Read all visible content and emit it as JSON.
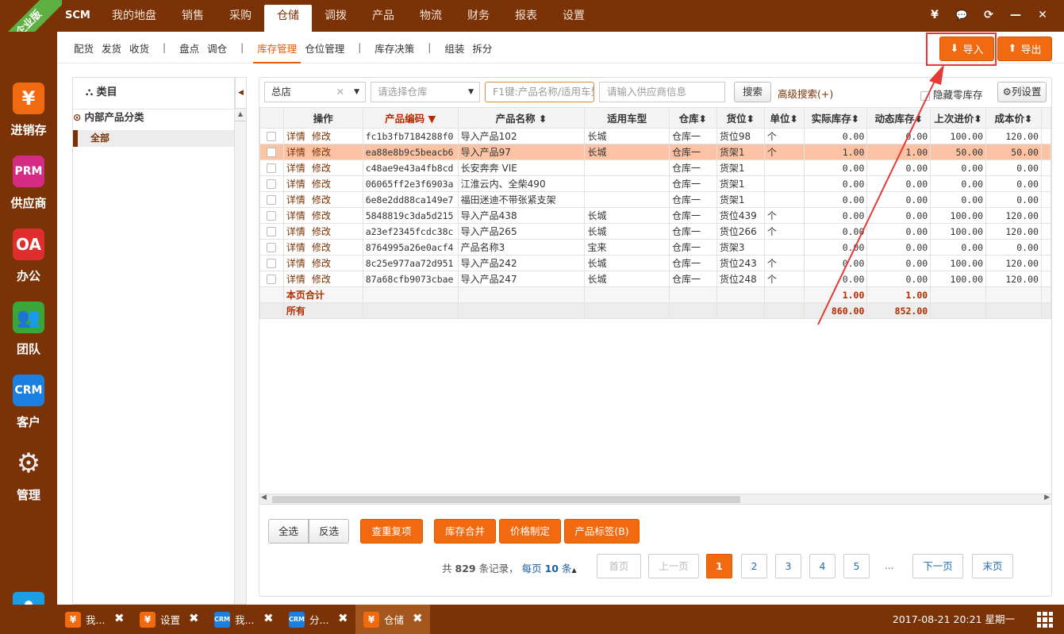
{
  "app": {
    "brand": "SCM",
    "edition_ribbon": "企业版"
  },
  "topnav": [
    "我的地盘",
    "销售",
    "采购",
    "仓储",
    "调拨",
    "产品",
    "物流",
    "财务",
    "报表",
    "设置"
  ],
  "topnav_active": "仓储",
  "window_controls": {
    "currency": "¥",
    "chat": "💬",
    "refresh": "⟳",
    "minimize": "—",
    "close": "✕"
  },
  "sidebar": [
    {
      "icon": "¥",
      "label": "进销存",
      "color": "#f16a10"
    },
    {
      "icon": "PRM",
      "label": "供应商",
      "color": "#d62b85"
    },
    {
      "icon": "OA",
      "label": "办公",
      "color": "#e02d2d"
    },
    {
      "icon": "👥",
      "label": "团队",
      "color": "#3aa63a"
    },
    {
      "icon": "CRM",
      "label": "客户",
      "color": "#1a7fe0"
    },
    {
      "icon": "⚙",
      "label": "管理",
      "color": "#7a3206"
    }
  ],
  "subnav": {
    "groups": [
      [
        "配货",
        "发货",
        "收货"
      ],
      [
        "盘点",
        "调仓"
      ],
      [
        "库存管理",
        "仓位管理"
      ],
      [
        "库存决策"
      ],
      [
        "组装",
        "拆分"
      ]
    ],
    "active": "库存管理",
    "import_label": "导入",
    "export_label": "导出"
  },
  "category": {
    "title": "类目",
    "root": "内部产品分类",
    "all": "全部"
  },
  "filters": {
    "store": "总店",
    "warehouse_placeholder": "请选择仓库",
    "product_placeholder": "F1键:产品名称/适用车型",
    "supplier_placeholder": "请输入供应商信息",
    "search_label": "搜索",
    "advanced_label": "高级搜索(+)",
    "hide_zero_label": "隐藏零库存",
    "column_settings_label": "列设置"
  },
  "table": {
    "headers": [
      "操作",
      "产品编码",
      "产品名称",
      "适用车型",
      "仓库",
      "货位",
      "单位",
      "实际库存",
      "动态库存",
      "上次进价",
      "成本价"
    ],
    "detail_label": "详情",
    "edit_label": "修改",
    "rows": [
      {
        "code": "fc1b3fb7184288f0",
        "name": "导入产品102",
        "car": "长城",
        "wh": "仓库一",
        "loc": "货位98",
        "unit": "个",
        "actual": "0.00",
        "dynamic": "0.00",
        "last_price": "100.00",
        "cost": "120.00"
      },
      {
        "code": "ea88e8b9c5beacb6",
        "name": "导入产品97",
        "car": "长城",
        "wh": "仓库一",
        "loc": "货架1",
        "unit": "个",
        "actual": "1.00",
        "dynamic": "1.00",
        "last_price": "50.00",
        "cost": "50.00"
      },
      {
        "code": "c48ae9e43a4fb8cd",
        "name": "长安奔奔 VIE",
        "car": "",
        "wh": "仓库一",
        "loc": "货架1",
        "unit": "",
        "actual": "0.00",
        "dynamic": "0.00",
        "last_price": "0.00",
        "cost": "0.00"
      },
      {
        "code": "06065ff2e3f6903a",
        "name": "江淮云内、全柴490",
        "car": "",
        "wh": "仓库一",
        "loc": "货架1",
        "unit": "",
        "actual": "0.00",
        "dynamic": "0.00",
        "last_price": "0.00",
        "cost": "0.00"
      },
      {
        "code": "6e8e2dd88ca149e7",
        "name": "福田迷迪不带张紧支架",
        "car": "",
        "wh": "仓库一",
        "loc": "货架1",
        "unit": "",
        "actual": "0.00",
        "dynamic": "0.00",
        "last_price": "0.00",
        "cost": "0.00"
      },
      {
        "code": "5848819c3da5d215",
        "name": "导入产品438",
        "car": "长城",
        "wh": "仓库一",
        "loc": "货位439",
        "unit": "个",
        "actual": "0.00",
        "dynamic": "0.00",
        "last_price": "100.00",
        "cost": "120.00"
      },
      {
        "code": "a23ef2345fcdc38c",
        "name": "导入产品265",
        "car": "长城",
        "wh": "仓库一",
        "loc": "货位266",
        "unit": "个",
        "actual": "0.00",
        "dynamic": "0.00",
        "last_price": "100.00",
        "cost": "120.00"
      },
      {
        "code": "8764995a26e0acf4",
        "name": "产品名称3",
        "car": "宝来",
        "wh": "仓库一",
        "loc": "货架3",
        "unit": "",
        "actual": "0.00",
        "dynamic": "0.00",
        "last_price": "0.00",
        "cost": "0.00"
      },
      {
        "code": "8c25e977aa72d951",
        "name": "导入产品242",
        "car": "长城",
        "wh": "仓库一",
        "loc": "货位243",
        "unit": "个",
        "actual": "0.00",
        "dynamic": "0.00",
        "last_price": "100.00",
        "cost": "120.00"
      },
      {
        "code": "87a68cfb9073cbae",
        "name": "导入产品247",
        "car": "长城",
        "wh": "仓库一",
        "loc": "货位248",
        "unit": "个",
        "actual": "0.00",
        "dynamic": "0.00",
        "last_price": "100.00",
        "cost": "120.00"
      }
    ],
    "page_total_label": "本页合计",
    "page_total_actual": "1.00",
    "page_total_dynamic": "1.00",
    "all_label": "所有",
    "all_actual": "860.00",
    "all_dynamic": "852.00"
  },
  "actions": {
    "select_all": "全选",
    "invert": "反选",
    "dedupe": "查重复项",
    "merge": "库存合并",
    "pricing": "价格制定",
    "label": "产品标签(B)"
  },
  "pager": {
    "total_prefix": "共",
    "total_count": "829",
    "total_suffix": "条记录，",
    "per_page_prefix": "每页",
    "per_page": "10",
    "per_page_suffix": "条",
    "first": "首页",
    "prev": "上一页",
    "pages": [
      "1",
      "2",
      "3",
      "4",
      "5"
    ],
    "ellipsis": "...",
    "next": "下一页",
    "last": "末页",
    "current": "1"
  },
  "taskbar": {
    "tasks": [
      {
        "icon": "¥",
        "label": "我...",
        "color": "#f16a10"
      },
      {
        "icon": "¥",
        "label": "设置",
        "color": "#f16a10"
      },
      {
        "icon": "CRM",
        "label": "我...",
        "color": "#1a7fe0"
      },
      {
        "icon": "CRM",
        "label": "分...",
        "color": "#1a7fe0"
      },
      {
        "icon": "¥",
        "label": "仓储",
        "color": "#f16a10"
      }
    ],
    "clock": "2017-08-21 20:21 星期一"
  }
}
